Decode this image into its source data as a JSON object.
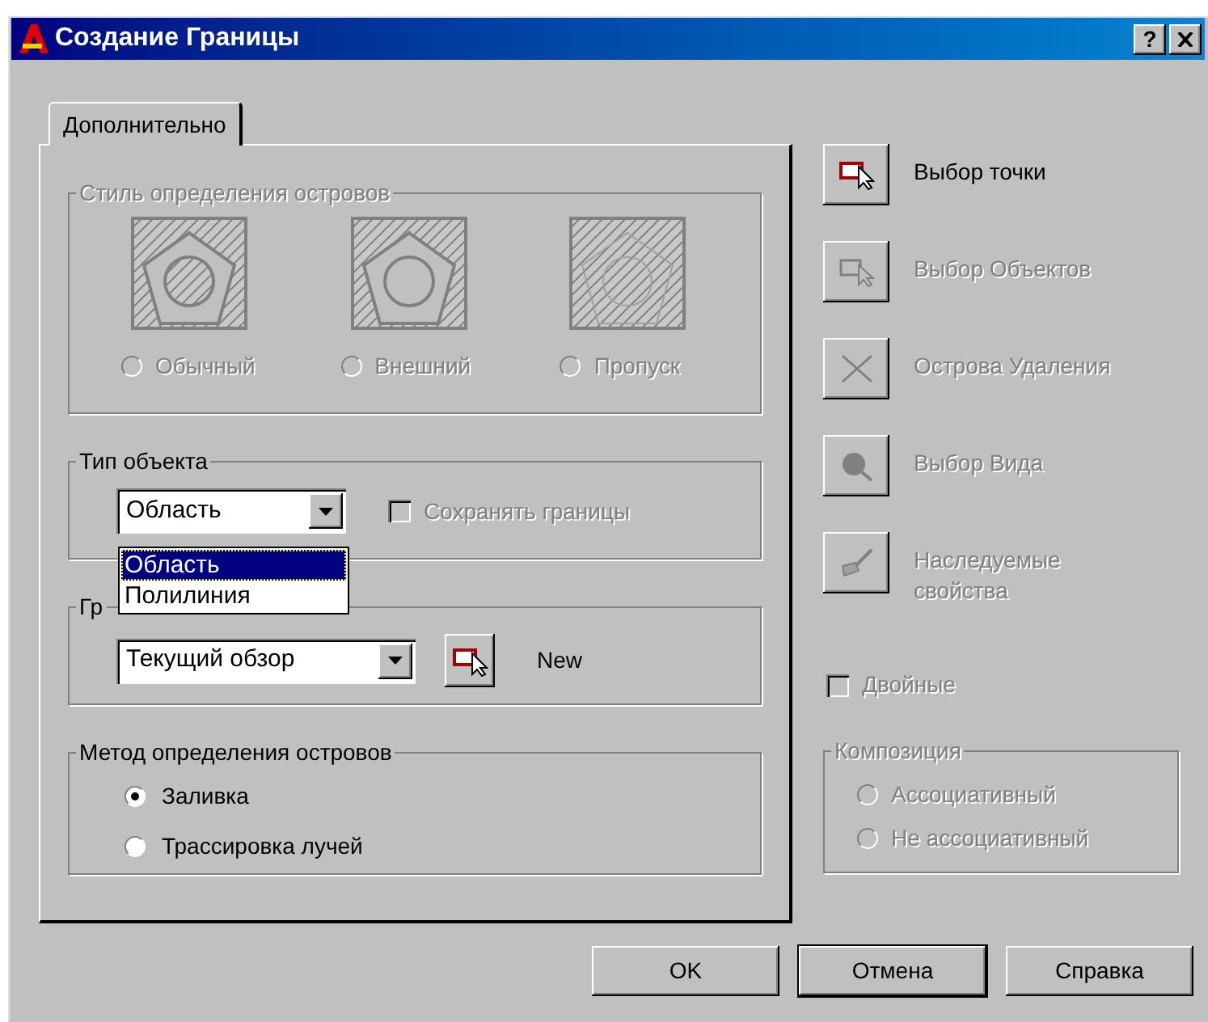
{
  "window": {
    "title": "Создание Границы",
    "help_button": "?"
  },
  "tabs": [
    {
      "label": "Дополнительно",
      "selected": true
    }
  ],
  "island_style": {
    "title": "Стиль определения островов",
    "disabled": true,
    "options": [
      {
        "label": "Обычный",
        "selected": false,
        "kind": "normal"
      },
      {
        "label": "Внешний",
        "selected": false,
        "kind": "outer"
      },
      {
        "label": "Пропуск",
        "selected": false,
        "kind": "ignore"
      }
    ]
  },
  "object_type": {
    "title": "Тип объекта",
    "value": "Область",
    "dropdown_open": true,
    "options": [
      {
        "label": "Область",
        "selected": true
      },
      {
        "label": "Полилиния",
        "selected": false
      }
    ],
    "keep_boundaries": {
      "label": "Сохранять границы",
      "checked": false,
      "disabled": true
    }
  },
  "boundary_set": {
    "title": "Гр",
    "value": "Текущий обзор",
    "new_label": "New"
  },
  "island_detection": {
    "title": "Метод определения островов",
    "options": [
      {
        "label": "Заливка",
        "selected": true
      },
      {
        "label": "Трассировка лучей",
        "selected": false
      }
    ]
  },
  "actions": [
    {
      "label": "Выбор точки",
      "disabled": false,
      "kind": "pick-point"
    },
    {
      "label": "Выбор Объектов",
      "disabled": true,
      "kind": "select-objects"
    },
    {
      "label": "Острова Удаления",
      "disabled": true,
      "kind": "remove"
    },
    {
      "label": "Выбор Вида",
      "disabled": true,
      "kind": "view"
    },
    {
      "label": "Наследуемые свойства",
      "disabled": true,
      "kind": "inherit"
    }
  ],
  "double": {
    "label": "Двойные",
    "checked": false,
    "disabled": true
  },
  "composition": {
    "title": "Композиция",
    "disabled": true,
    "options": [
      {
        "label": "Ассоциативный",
        "selected": false
      },
      {
        "label": "Не ассоциативный",
        "selected": false
      }
    ]
  },
  "buttons": [
    {
      "label": "OK",
      "default": false
    },
    {
      "label": "Отмена",
      "default": true
    },
    {
      "label": "Справка",
      "default": false
    }
  ]
}
